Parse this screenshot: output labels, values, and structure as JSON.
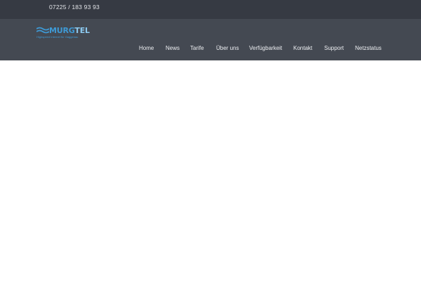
{
  "topbar": {
    "phone": "07225 / 183 93 93"
  },
  "logo": {
    "name_dark": "MURG",
    "name_light": "TEL",
    "tagline": "Highspeed Internet für Gaggenau",
    "icon": "wave-logo-icon",
    "color": "#3e9ad6"
  },
  "nav": {
    "items": [
      {
        "label": "Home"
      },
      {
        "label": "News"
      },
      {
        "label": "Tarife"
      },
      {
        "label": "Über uns"
      },
      {
        "label": "Verfügbarkeit"
      },
      {
        "label": "Kontakt"
      },
      {
        "label": "Support"
      },
      {
        "label": "Netzstatus"
      }
    ]
  },
  "colors": {
    "topbar": "#363a43",
    "navbar": "#444952",
    "nav_text": "#eef0f3",
    "content": "#ffffff"
  }
}
